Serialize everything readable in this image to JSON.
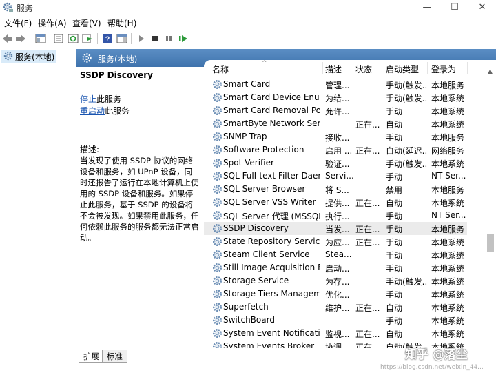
{
  "window": {
    "title": "服务",
    "minimize": "—",
    "maximize": "☐",
    "close": "✕"
  },
  "menu": [
    "文件(F)",
    "操作(A)",
    "查看(V)",
    "帮助(H)"
  ],
  "tree": {
    "item": "服务(本地)"
  },
  "pane": {
    "header": "服务(本地)",
    "selected_name": "SSDP Discovery",
    "link_stop": "停止",
    "link_stop_suffix": "此服务",
    "link_restart": "重启动",
    "link_restart_suffix": "此服务",
    "desc_label": "描述:",
    "desc_text": "当发现了使用 SSDP 协议的网络设备和服务，如 UPnP 设备，同时还报告了运行在本地计算机上使用的 SSDP 设备和服务。如果停止此服务，基于 SSDP 的设备将不会被发现。如果禁用此服务，任何依赖此服务的服务都无法正常启动。"
  },
  "columns": {
    "name": "名称",
    "desc": "描述",
    "status": "状态",
    "start": "启动类型",
    "logon": "登录为"
  },
  "rows": [
    {
      "name": "Smart Card",
      "desc": "管理...",
      "status": "",
      "start": "手动(触发...",
      "logon": "本地服务"
    },
    {
      "name": "Smart Card Device Enumer...",
      "desc": "为给...",
      "status": "",
      "start": "手动(触发...",
      "logon": "本地系统"
    },
    {
      "name": "Smart Card Removal Policy",
      "desc": "允许...",
      "status": "",
      "start": "手动",
      "logon": "本地系统"
    },
    {
      "name": "SmartByte Network Service",
      "desc": "",
      "status": "正在...",
      "start": "自动",
      "logon": "本地系统"
    },
    {
      "name": "SNMP Trap",
      "desc": "接收...",
      "status": "",
      "start": "手动",
      "logon": "本地服务"
    },
    {
      "name": "Software Protection",
      "desc": "启用 ...",
      "status": "正在...",
      "start": "自动(延迟...",
      "logon": "网络服务"
    },
    {
      "name": "Spot Verifier",
      "desc": "验证...",
      "status": "",
      "start": "手动(触发...",
      "logon": "本地系统"
    },
    {
      "name": "SQL Full-text Filter Daemo...",
      "desc": "Servi...",
      "status": "",
      "start": "手动",
      "logon": "NT Ser..."
    },
    {
      "name": "SQL Server Browser",
      "desc": "将 S...",
      "status": "",
      "start": "禁用",
      "logon": "本地服务"
    },
    {
      "name": "SQL Server VSS Writer",
      "desc": "提供...",
      "status": "正在...",
      "start": "自动",
      "logon": "本地系统"
    },
    {
      "name": "SQL Server 代理 (MSSQLS...",
      "desc": "执行...",
      "status": "",
      "start": "手动",
      "logon": "NT Ser..."
    },
    {
      "name": "SSDP Discovery",
      "desc": "当发...",
      "status": "正在...",
      "start": "手动",
      "logon": "本地服务"
    },
    {
      "name": "State Repository Service",
      "desc": "为应...",
      "status": "正在...",
      "start": "手动",
      "logon": "本地系统"
    },
    {
      "name": "Steam Client Service",
      "desc": "Stea...",
      "status": "",
      "start": "手动",
      "logon": "本地系统"
    },
    {
      "name": "Still Image Acquisition Eve...",
      "desc": "启动...",
      "status": "",
      "start": "手动",
      "logon": "本地系统"
    },
    {
      "name": "Storage Service",
      "desc": "为存...",
      "status": "",
      "start": "手动(触发...",
      "logon": "本地系统"
    },
    {
      "name": "Storage Tiers Management",
      "desc": "优化...",
      "status": "",
      "start": "手动",
      "logon": "本地系统"
    },
    {
      "name": "Superfetch",
      "desc": "维护...",
      "status": "正在...",
      "start": "自动",
      "logon": "本地系统"
    },
    {
      "name": "SwitchBoard",
      "desc": "",
      "status": "",
      "start": "手动",
      "logon": "本地系统"
    },
    {
      "name": "System Event Notification ...",
      "desc": "监视...",
      "status": "正在...",
      "start": "自动",
      "logon": "本地系统"
    },
    {
      "name": "System Events Broker",
      "desc": "协调...",
      "status": "正在...",
      "start": "自动(触发...",
      "logon": "本地系统"
    }
  ],
  "selected_index": 11,
  "tabs": [
    "扩展",
    "标准"
  ],
  "watermark": "知乎 @落尘",
  "watermark_url": "https://blog.csdn.net/weixin_44..."
}
